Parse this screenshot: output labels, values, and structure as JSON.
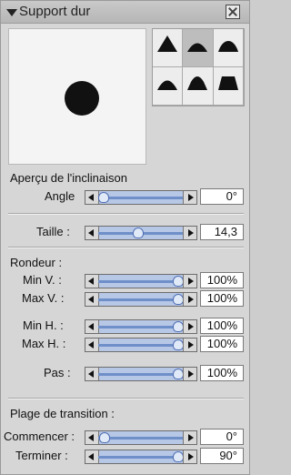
{
  "window": {
    "title": "Support dur"
  },
  "sections": {
    "preview_label": "Aperçu de l'inclinaison",
    "angle": {
      "label": "Angle",
      "value": "0°",
      "position": 0.04
    },
    "taille": {
      "label": "Taille :",
      "value": "14,3",
      "position": 0.45
    },
    "rondeur": {
      "title": "Rondeur :",
      "items": [
        {
          "label": "Min V. :",
          "value": "100%",
          "position": 1.0
        },
        {
          "label": "Max V. :",
          "value": "100%",
          "position": 1.0
        },
        {
          "label": "Min H. :",
          "value": "100%",
          "position": 1.0
        },
        {
          "label": "Max H. :",
          "value": "100%",
          "position": 1.0
        },
        {
          "label": "Pas :",
          "value": "100%",
          "position": 1.0
        }
      ]
    },
    "transition": {
      "title": "Plage de transition :",
      "start": {
        "label": "Commencer :",
        "value": "0°",
        "position": 0.0
      },
      "end": {
        "label": "Terminer :",
        "value": "90°",
        "position": 1.0
      }
    }
  },
  "preview": {
    "shape": "round-dot"
  },
  "brush_shapes": [
    {
      "name": "triangle-shape-icon",
      "selected": false
    },
    {
      "name": "dome-shape-icon",
      "selected": true
    },
    {
      "name": "rounded-trapezoid-shape-icon",
      "selected": false
    },
    {
      "name": "round-hill-shape-icon",
      "selected": false
    },
    {
      "name": "bell-shape-icon",
      "selected": false
    },
    {
      "name": "trapezoid-shape-icon",
      "selected": false
    }
  ],
  "colors": {
    "slider_fill": "#b7c7e6",
    "slider_track": "#6f8fc9"
  }
}
